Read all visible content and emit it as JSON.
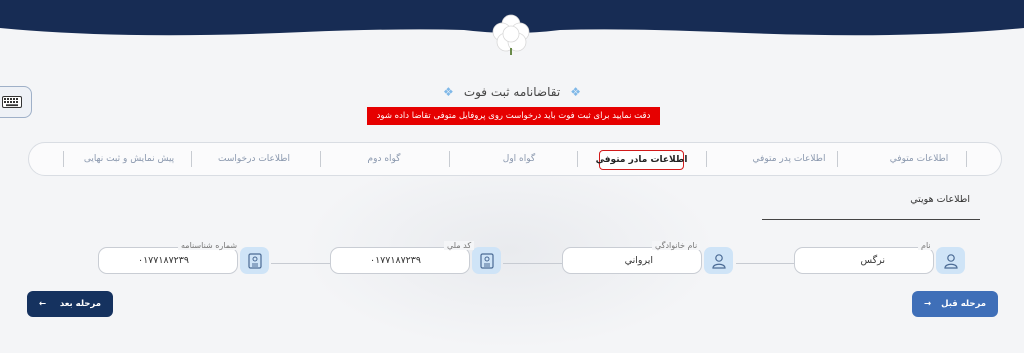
{
  "header": {
    "flower_icon": "white-flower-icon",
    "band_color": "#172c54"
  },
  "keyboard_icon": "keyboard-icon",
  "title": "تقاضانامه ثبت فوت",
  "warning": "دقت نمایید برای ثبت فوت باید درخواست روی پروفایل متوفی تقاضا داده شود",
  "steps": [
    "اطلاعات متوفي",
    "اطلاعات پدر متوفي",
    "اطلاعات مادر متوفي",
    "گواه اول",
    "گواه دوم",
    "اطلاعات درخواست",
    "پیش نمایش و ثبت نهایی"
  ],
  "active_step": "اطلاعات مادر متوفي",
  "section": {
    "title": "اطلاعات هويتي"
  },
  "fields": {
    "first_name": {
      "label": "نام",
      "value": "نرگس",
      "icon": "user-icon"
    },
    "last_name": {
      "label": "نام خانوادگي",
      "value": "ايرواني",
      "icon": "user-icon"
    },
    "national_code": {
      "label": "كد ملي",
      "value": "۰۱۷۷۱۸۷۲۳۹",
      "icon": "id-card-icon"
    },
    "id_number": {
      "label": "شماره شناسنامه",
      "value": "۰۱۷۷۱۸۷۲۳۹",
      "icon": "id-card-icon"
    }
  },
  "buttons": {
    "next": "مرحله بعد",
    "prev": "مرحله قبل"
  },
  "colors": {
    "navy": "#172c54",
    "warning_red": "#e60000",
    "active_border": "#d21a1a",
    "prev_button": "#3f6fb8",
    "next_button": "#15325f",
    "icon_bg": "#cfe4f7"
  }
}
